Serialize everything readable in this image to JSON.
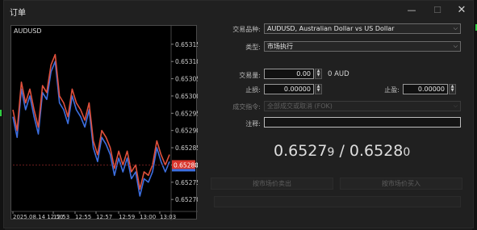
{
  "window": {
    "title": "订单",
    "min_glyph": "—",
    "max_glyph": "☐",
    "close_glyph": "✕"
  },
  "chart": {
    "symbol": "AUDUSD",
    "current_price": "0.65280",
    "y_ticks": [
      "0.65315",
      "0.65310",
      "0.65305",
      "0.65300",
      "0.65295",
      "0.65290",
      "0.65285",
      "0.65280",
      "0.65275",
      "0.65270"
    ],
    "x_ticks": [
      "2025.08.14 12:50",
      "12:53",
      "12:55",
      "12:57",
      "12:59",
      "13:00",
      "13:03"
    ],
    "bid_color": "#3d6fe0",
    "ask_color": "#e0503c"
  },
  "chart_data": {
    "type": "line",
    "x": [
      "12:50",
      "12:53",
      "12:55",
      "12:57",
      "12:59",
      "13:00",
      "13:03"
    ],
    "ylim": [
      0.65267,
      0.65318
    ],
    "series": [
      {
        "values": [
          0.65294,
          0.65288,
          0.65302,
          0.65296,
          0.653,
          0.65294,
          0.65289,
          0.65301,
          0.65299,
          0.65307,
          0.6531,
          0.65298,
          0.65296,
          0.65292,
          0.653,
          0.65296,
          0.65294,
          0.65291,
          0.65296,
          0.65285,
          0.65281,
          0.65288,
          0.65286,
          0.65283,
          0.65277,
          0.65282,
          0.65278,
          0.65282,
          0.65276,
          0.65278,
          0.65271,
          0.65276,
          0.65275,
          0.65278,
          0.65285,
          0.65281,
          0.65278,
          0.65281
        ]
      },
      {
        "values": [
          0.65296,
          0.6529,
          0.65304,
          0.65298,
          0.65302,
          0.65296,
          0.65291,
          0.65303,
          0.65301,
          0.65309,
          0.65312,
          0.653,
          0.65298,
          0.65294,
          0.65302,
          0.65298,
          0.65296,
          0.65293,
          0.65298,
          0.65287,
          0.65283,
          0.6529,
          0.65288,
          0.65285,
          0.65279,
          0.65284,
          0.6528,
          0.65284,
          0.65278,
          0.6528,
          0.65273,
          0.65278,
          0.65277,
          0.6528,
          0.65287,
          0.65283,
          0.6528,
          0.65283
        ]
      }
    ]
  },
  "form": {
    "symbol_label": "交易品种:",
    "symbol_value": "AUDUSD, Australian Dollar vs US Dollar",
    "type_label": "类型:",
    "type_value": "市场执行",
    "volume_label": "交易量:",
    "volume_value": "0.00",
    "volume_unit": "0 AUD",
    "sl_label": "止损:",
    "sl_value": "0.00000",
    "tp_label": "止盈:",
    "tp_value": "0.00000",
    "fill_label": "成交指令:",
    "fill_value": "全部成交或取消 (FOK)",
    "comment_label": "注释:",
    "comment_value": ""
  },
  "quote": {
    "bid_main": "0.6527",
    "bid_small": "9",
    "separator": " / ",
    "ask_main": "0.6528",
    "ask_small": "0"
  },
  "buttons": {
    "sell": "按市场价卖出",
    "buy": "按市场价买入"
  },
  "icons": {
    "dropdown": "⌵",
    "spin_up": "▲",
    "spin_down": "▼"
  }
}
